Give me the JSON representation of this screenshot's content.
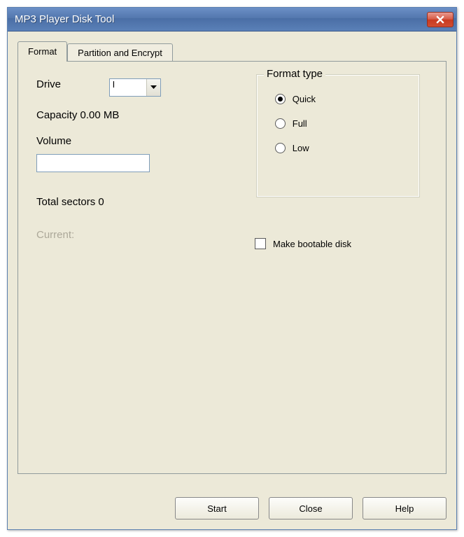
{
  "window": {
    "title": "MP3 Player Disk Tool"
  },
  "tabs": [
    {
      "label": "Format",
      "active": true
    },
    {
      "label": "Partition and Encrypt",
      "active": false
    }
  ],
  "format": {
    "drive_label": "Drive",
    "drive_value": "I",
    "capacity_label": "Capacity 0.00 MB",
    "volume_label": "Volume",
    "volume_value": "",
    "total_sectors_label": "Total sectors 0",
    "current_label": "Current:"
  },
  "format_type": {
    "group_label": "Format type",
    "options": [
      {
        "label": "Quick",
        "checked": true
      },
      {
        "label": "Full",
        "checked": false
      },
      {
        "label": "Low",
        "checked": false
      }
    ]
  },
  "bootable": {
    "label": "Make bootable disk",
    "checked": false
  },
  "buttons": {
    "start": "Start",
    "close": "Close",
    "help": "Help"
  }
}
